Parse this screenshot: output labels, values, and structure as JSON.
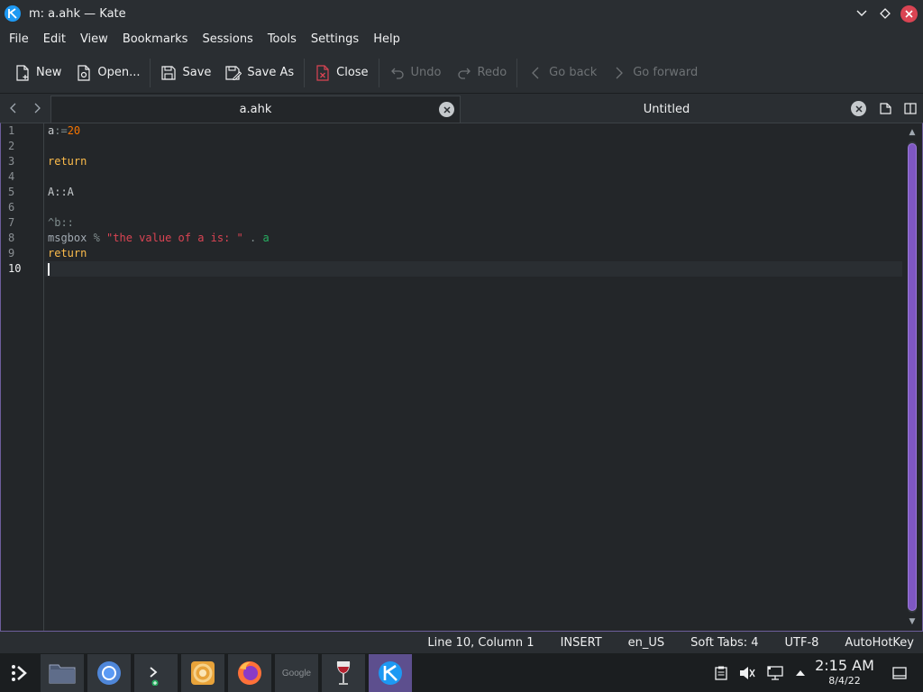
{
  "window": {
    "title": "m: a.ahk — Kate",
    "controls": {
      "minimize": "⌄",
      "maximize": "◇",
      "close": "✕"
    }
  },
  "menu": [
    "File",
    "Edit",
    "View",
    "Bookmarks",
    "Sessions",
    "Tools",
    "Settings",
    "Help"
  ],
  "toolbar": {
    "new": "New",
    "open": "Open...",
    "save": "Save",
    "save_as": "Save As",
    "close": "Close",
    "undo": "Undo",
    "redo": "Redo",
    "go_back": "Go back",
    "go_forward": "Go forward"
  },
  "tabs": [
    {
      "label": "a.ahk",
      "active": true
    },
    {
      "label": "Untitled",
      "active": false
    }
  ],
  "editor": {
    "line_numbers": [
      "1",
      "2",
      "3",
      "4",
      "5",
      "6",
      "7",
      "8",
      "9",
      "10"
    ],
    "current_line": 10,
    "lines": [
      [
        {
          "t": "a",
          "c": "var"
        },
        {
          "t": ":=",
          "c": "op"
        },
        {
          "t": "20",
          "c": "num"
        }
      ],
      [],
      [
        {
          "t": "return",
          "c": "kw"
        }
      ],
      [],
      [
        {
          "t": "A::A",
          "c": "label"
        }
      ],
      [],
      [
        {
          "t": "^b::",
          "c": "hotkey"
        }
      ],
      [
        {
          "t": "msgbox",
          "c": "cmd"
        },
        {
          "t": " % ",
          "c": "op"
        },
        {
          "t": "\"the value of a is: \"",
          "c": "str"
        },
        {
          "t": " . ",
          "c": "op"
        },
        {
          "t": "a",
          "c": "ref"
        }
      ],
      [
        {
          "t": "return",
          "c": "kw"
        }
      ],
      []
    ]
  },
  "status": {
    "position": "Line 10, Column 1",
    "mode": "INSERT",
    "language": "en_US",
    "indent": "Soft Tabs: 4",
    "encoding": "UTF-8",
    "syntax": "AutoHotKey"
  },
  "taskbar": {
    "apps": [
      "file-manager",
      "chromium",
      "konsole",
      "settings",
      "firefox",
      "google",
      "wine",
      "kate"
    ],
    "google_label": "Google",
    "clock_time": "2:15 AM",
    "clock_date": "8/4/22"
  },
  "colors": {
    "accent": "#7e57c2",
    "background": "#232629",
    "panel": "#2a2e32",
    "keyword": "#fdbc4b",
    "number": "#f67400",
    "string": "#da4453",
    "reference": "#27ae60"
  }
}
